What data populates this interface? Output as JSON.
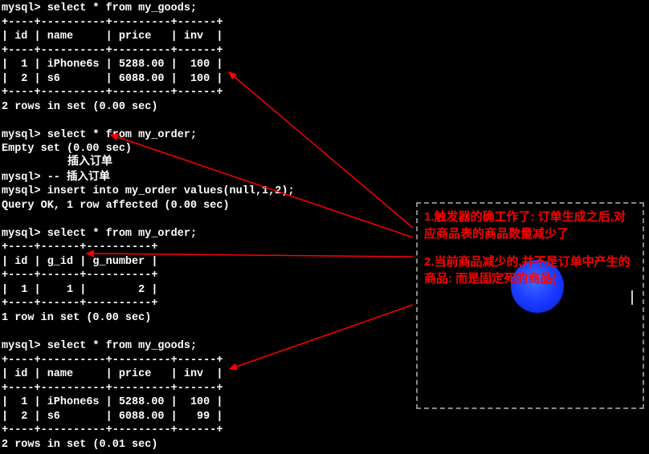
{
  "terminal": {
    "block1": "mysql> select * from my_goods;\n+----+----------+---------+------+\n| id | name     | price   | inv  |\n+----+----------+---------+------+\n|  1 | iPhone6s | 5288.00 |  100 |\n|  2 | s6       | 6088.00 |  100 |\n+----+----------+---------+------+\n2 rows in set (0.00 sec)\n\nmysql> select * from my_order;\nEmpty set (0.00 sec)\n\nmysql> -- 插入订单\nmysql> insert into my_order values(null,1,2);\nQuery OK, 1 row affected (0.00 sec)\n\nmysql> select * from my_order;\n+----+------+----------+\n| id | g_id | g_number |\n+----+------+----------+\n|  1 |    1 |        2 |\n+----+------+----------+\n1 row in set (0.00 sec)\n\nmysql> select * from my_goods;\n+----+----------+---------+------+\n| id | name     | price   | inv  |\n+----+----------+---------+------+\n|  1 | iPhone6s | 5288.00 |  100 |\n|  2 | s6       | 6088.00 |   99 |\n+----+----------+---------+------+\n2 rows in set (0.01 sec)"
  },
  "overlay": {
    "insert_cn": "插入订单"
  },
  "annotation": {
    "note1": "1.触发器的确工作了: 订单生成之后,对应商品表的商品数量减少了",
    "note2": "2.当前商品减少的,并不是订单中产生的商品: 而是固定死的商品("
  }
}
